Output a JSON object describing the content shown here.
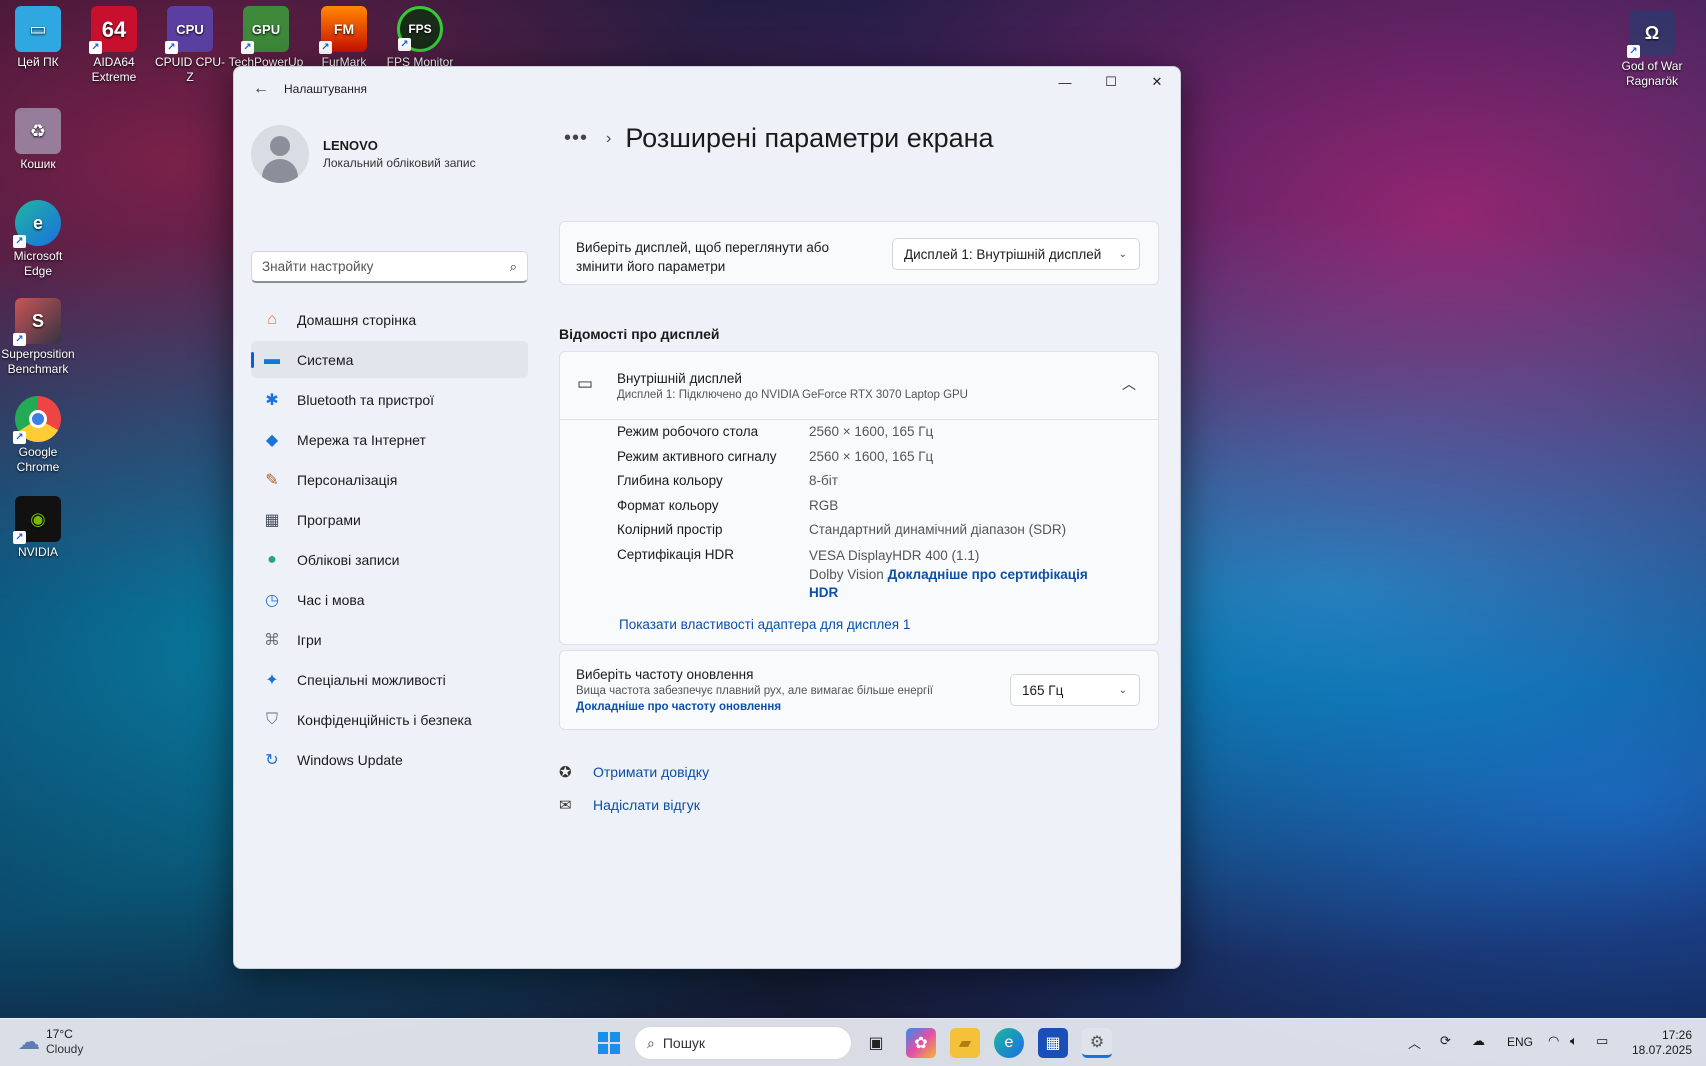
{
  "desktop": {
    "icons_left": [
      {
        "label": "Цей ПК",
        "icon": "this-pc-icon"
      },
      {
        "label": "Кошик",
        "icon": "recycle-bin-icon"
      },
      {
        "label": "Microsoft Edge",
        "icon": "edge-icon"
      },
      {
        "label": "Superposition Benchmark",
        "icon": "superposition-icon"
      },
      {
        "label": "Google Chrome",
        "icon": "chrome-icon"
      },
      {
        "label": "NVIDIA",
        "icon": "nvidia-icon"
      }
    ],
    "icons_top": [
      {
        "label": "AIDA64 Extreme",
        "glyph": "64"
      },
      {
        "label": "CPUID CPU-Z",
        "glyph": "CPU"
      },
      {
        "label": "TechPowerUp",
        "glyph": "GPU"
      },
      {
        "label": "FurMark",
        "glyph": "FM"
      },
      {
        "label": "FPS Monitor",
        "glyph": "FPS"
      }
    ],
    "icon_right": {
      "label": "God of War Ragnarök"
    }
  },
  "window": {
    "app_title": "Налаштування",
    "controls": {
      "minimize": "—",
      "maximize": "☐",
      "close": "✕"
    }
  },
  "profile": {
    "name": "LENOVO",
    "account_type": "Локальний обліковий запис"
  },
  "search": {
    "placeholder": "Знайти настройку"
  },
  "nav": [
    {
      "label": "Домашня сторінка",
      "icon": "home-icon",
      "glyph": "⌂",
      "color": "#e0743a"
    },
    {
      "label": "Система",
      "icon": "system-icon",
      "glyph": "▬",
      "color": "#1a73d9",
      "active": true
    },
    {
      "label": "Bluetooth та пристрої",
      "icon": "bluetooth-icon",
      "glyph": "✱",
      "color": "#1a73d9"
    },
    {
      "label": "Мережа та Інтернет",
      "icon": "wifi-icon",
      "glyph": "◆",
      "color": "#1a73d9"
    },
    {
      "label": "Персоналізація",
      "icon": "brush-icon",
      "glyph": "✎",
      "color": "#b85a1d"
    },
    {
      "label": "Програми",
      "icon": "apps-icon",
      "glyph": "▦",
      "color": "#4a5060"
    },
    {
      "label": "Облікові записи",
      "icon": "accounts-icon",
      "glyph": "●",
      "color": "#2ea37a"
    },
    {
      "label": "Час і мова",
      "icon": "time-language-icon",
      "glyph": "◷",
      "color": "#1a73d9"
    },
    {
      "label": "Ігри",
      "icon": "gamepad-icon",
      "glyph": "⌘",
      "color": "#6b7080"
    },
    {
      "label": "Спеціальні можливості",
      "icon": "accessibility-icon",
      "glyph": "✦",
      "color": "#1a73d9"
    },
    {
      "label": "Конфіденційність і безпека",
      "icon": "shield-icon",
      "glyph": "⛉",
      "color": "#6b7080"
    },
    {
      "label": "Windows Update",
      "icon": "update-icon",
      "glyph": "↻",
      "color": "#1a73d9"
    }
  ],
  "page": {
    "breadcrumb_more": "•••",
    "title": "Розширені параметри екрана"
  },
  "display_select": {
    "label": "Виберіть дисплей, щоб переглянути або змінити його параметри",
    "value": "Дисплей 1: Внутрішній дисплей"
  },
  "display_info": {
    "section_label": "Відомості про дисплей",
    "header_title": "Внутрішній дисплей",
    "header_sub": "Дисплей 1: Підключено до NVIDIA GeForce RTX 3070 Laptop GPU",
    "rows": [
      {
        "key": "Режим робочого стола",
        "value": "2560 × 1600, 165 Гц"
      },
      {
        "key": "Режим активного сигналу",
        "value": "2560 × 1600, 165 Гц"
      },
      {
        "key": "Глибина кольору",
        "value": "8-біт"
      },
      {
        "key": "Формат кольору",
        "value": "RGB"
      },
      {
        "key": "Колірний простір",
        "value": "Стандартний динамічний діапазон (SDR)"
      }
    ],
    "hdr_key": "Сертифікація HDR",
    "hdr_value_1": "VESA DisplayHDR 400 (1.1)",
    "hdr_value_2": "Dolby Vision",
    "hdr_link": "Докладніше про сертифікація HDR",
    "adapter_link": "Показати властивості адаптера для дисплея 1"
  },
  "refresh": {
    "title": "Виберіть частоту оновлення",
    "description": "Вища частота забезпечує плавний рух, але вимагає більше енергії",
    "link": "Докладніше про частоту оновлення",
    "value": "165 Гц"
  },
  "help": {
    "get_help": "Отримати довідку",
    "feedback": "Надіслати відгук"
  },
  "taskbar": {
    "weather_temp": "17°C",
    "weather_desc": "Cloudy",
    "search_placeholder": "Пошук",
    "language": "ENG",
    "time": "17:26",
    "date": "18.07.2025"
  }
}
